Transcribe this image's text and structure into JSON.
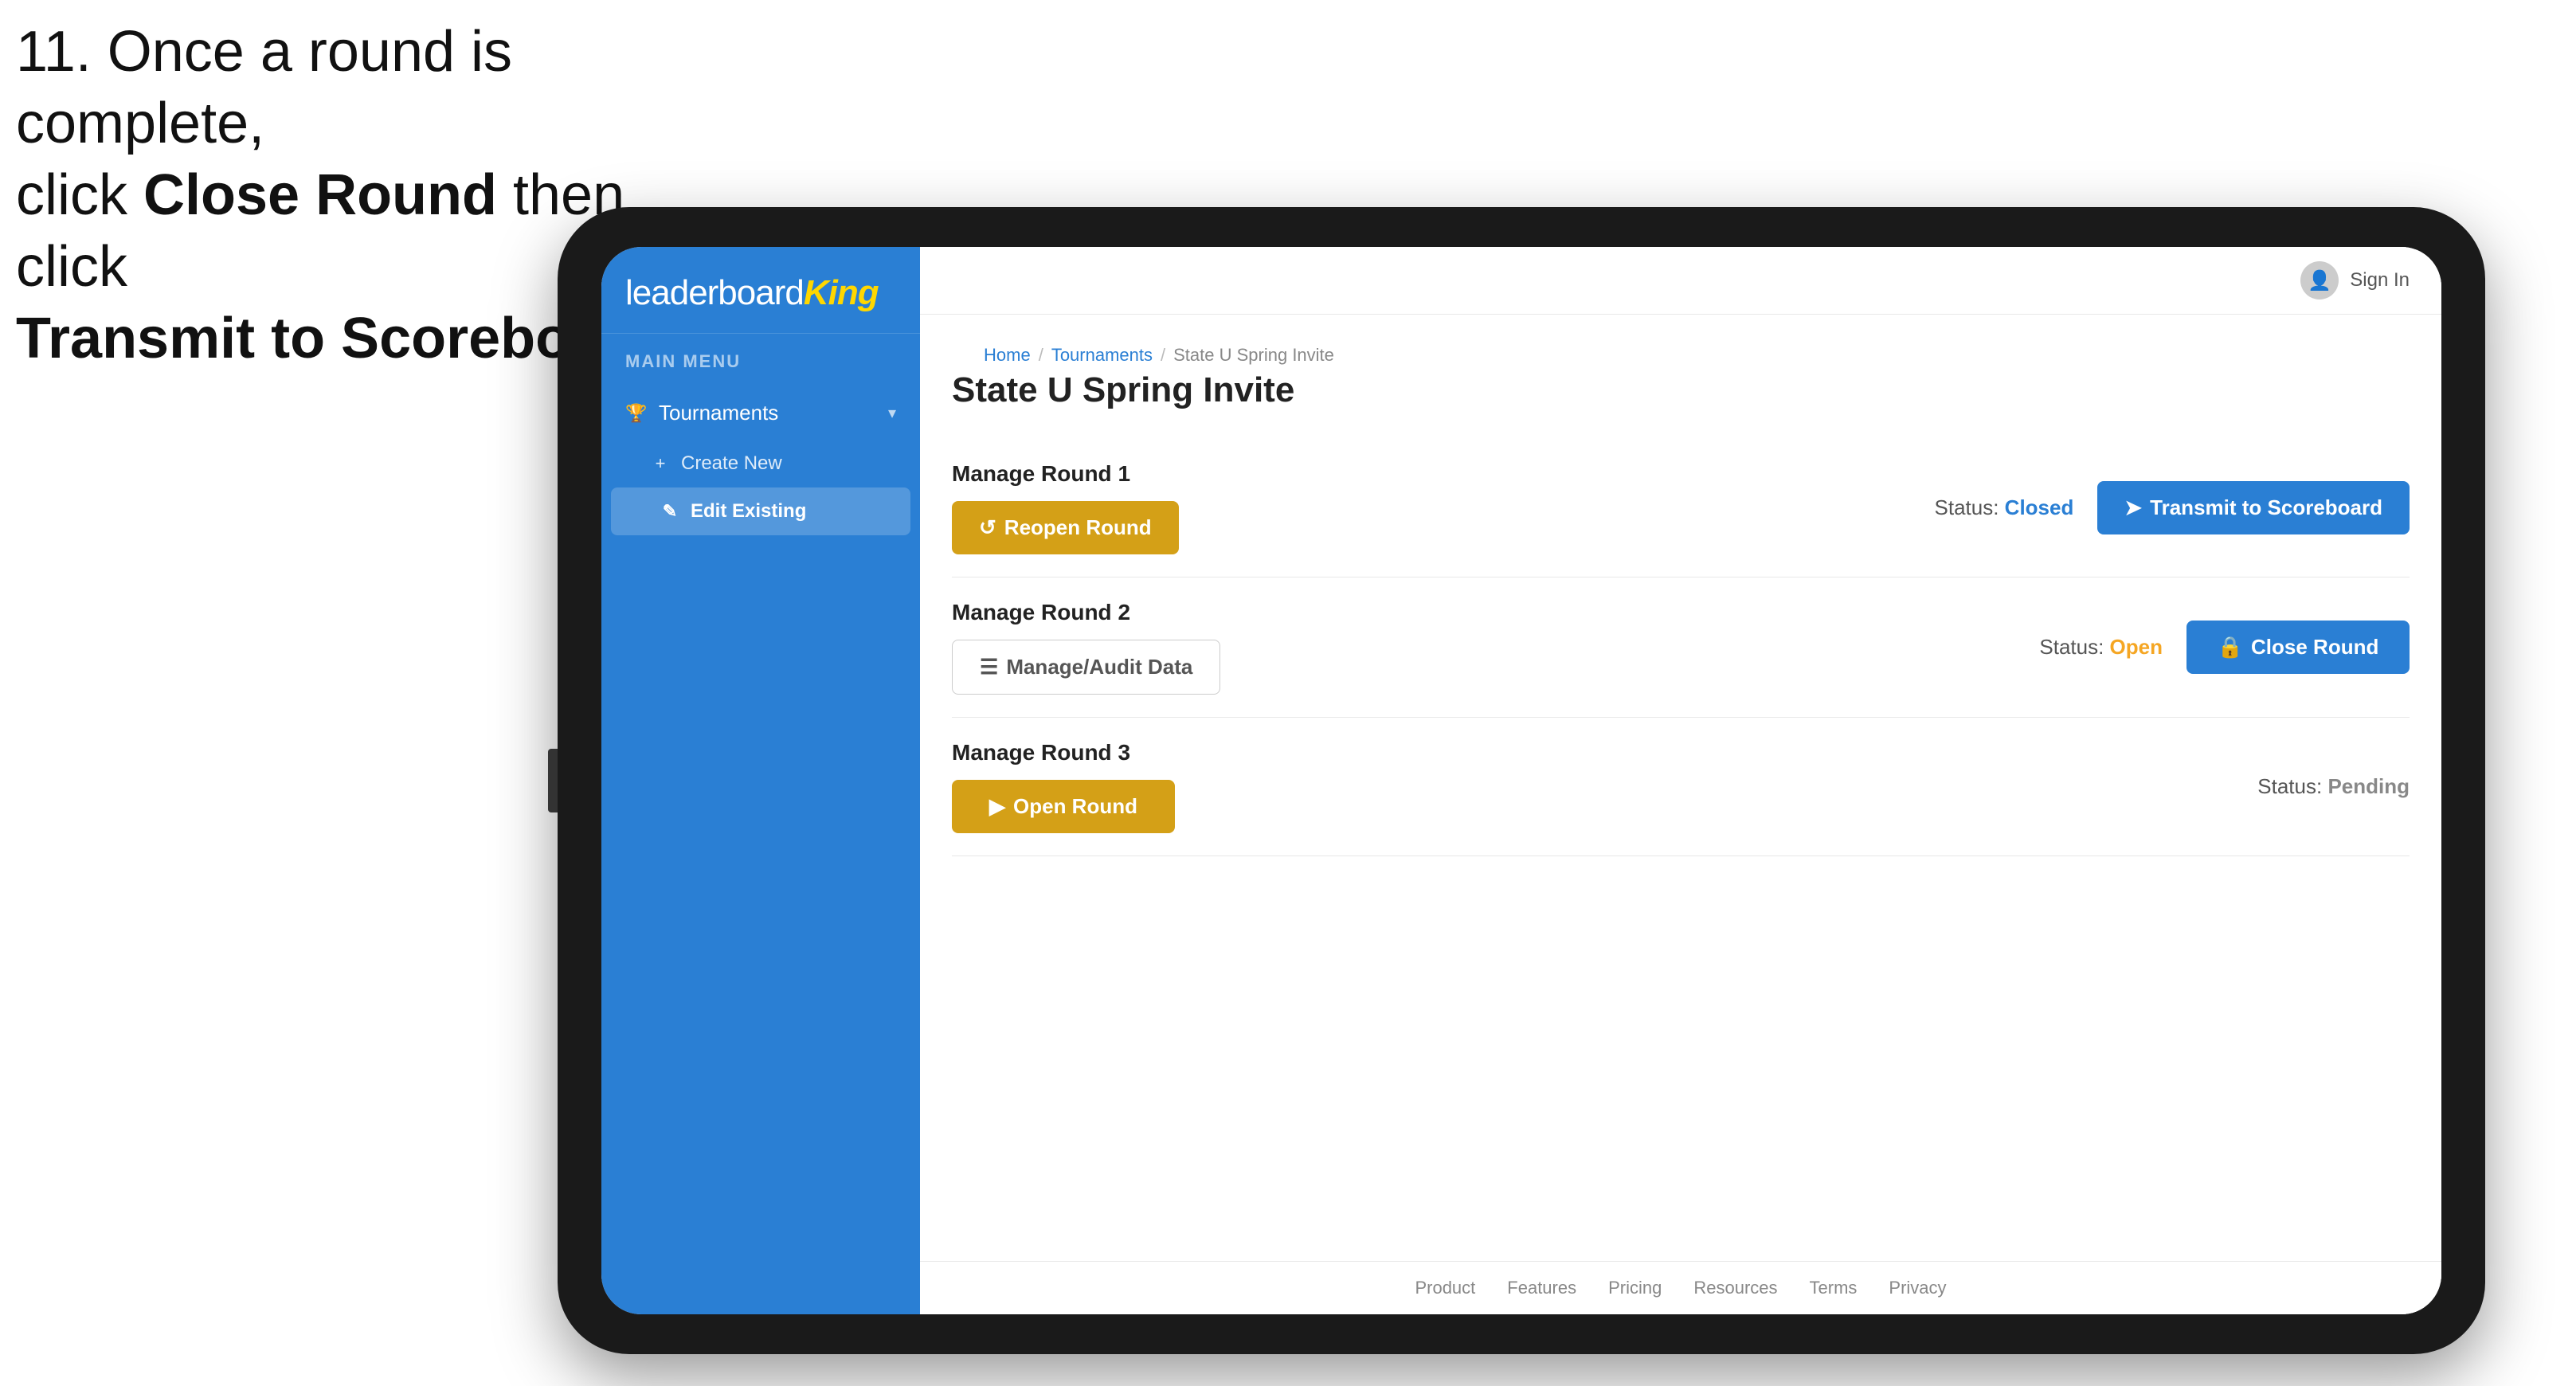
{
  "instruction": {
    "line1": "11. Once a round is complete,",
    "line2_prefix": "click ",
    "line2_bold": "Close Round",
    "line2_suffix": " then click",
    "line3_bold": "Transmit to Scoreboard."
  },
  "logo": {
    "leaderboard": "leaderboard",
    "king": "King"
  },
  "sidebar": {
    "menu_label": "MAIN MENU",
    "nav_items": [
      {
        "label": "Tournaments",
        "icon": "🏆",
        "has_chevron": true,
        "expanded": true
      }
    ],
    "sub_items": [
      {
        "label": "Create New",
        "icon": "+"
      },
      {
        "label": "Edit Existing",
        "icon": "✎",
        "active": true
      }
    ]
  },
  "topbar": {
    "sign_in": "Sign In"
  },
  "breadcrumb": {
    "home": "Home",
    "tournaments": "Tournaments",
    "current": "State U Spring Invite",
    "separator": "/"
  },
  "page": {
    "title": "State U Spring Invite",
    "rounds": [
      {
        "id": "round1",
        "label": "Manage Round 1",
        "status_label": "Status:",
        "status_value": "Closed",
        "status_type": "closed",
        "buttons": [
          {
            "id": "reopen",
            "label": "Reopen Round",
            "style": "gold",
            "icon": "↺"
          },
          {
            "id": "transmit",
            "label": "Transmit to Scoreboard",
            "style": "blue",
            "icon": "➤"
          }
        ]
      },
      {
        "id": "round2",
        "label": "Manage Round 2",
        "status_label": "Status:",
        "status_value": "Open",
        "status_type": "open",
        "buttons": [
          {
            "id": "audit",
            "label": "Manage/Audit Data",
            "style": "outline",
            "icon": "☰"
          },
          {
            "id": "close",
            "label": "Close Round",
            "style": "blue",
            "icon": "🔒"
          }
        ]
      },
      {
        "id": "round3",
        "label": "Manage Round 3",
        "status_label": "Status:",
        "status_value": "Pending",
        "status_type": "pending",
        "buttons": [
          {
            "id": "open",
            "label": "Open Round",
            "style": "gold",
            "icon": "▶"
          }
        ]
      }
    ]
  },
  "footer": {
    "links": [
      "Product",
      "Features",
      "Pricing",
      "Resources",
      "Terms",
      "Privacy"
    ]
  }
}
